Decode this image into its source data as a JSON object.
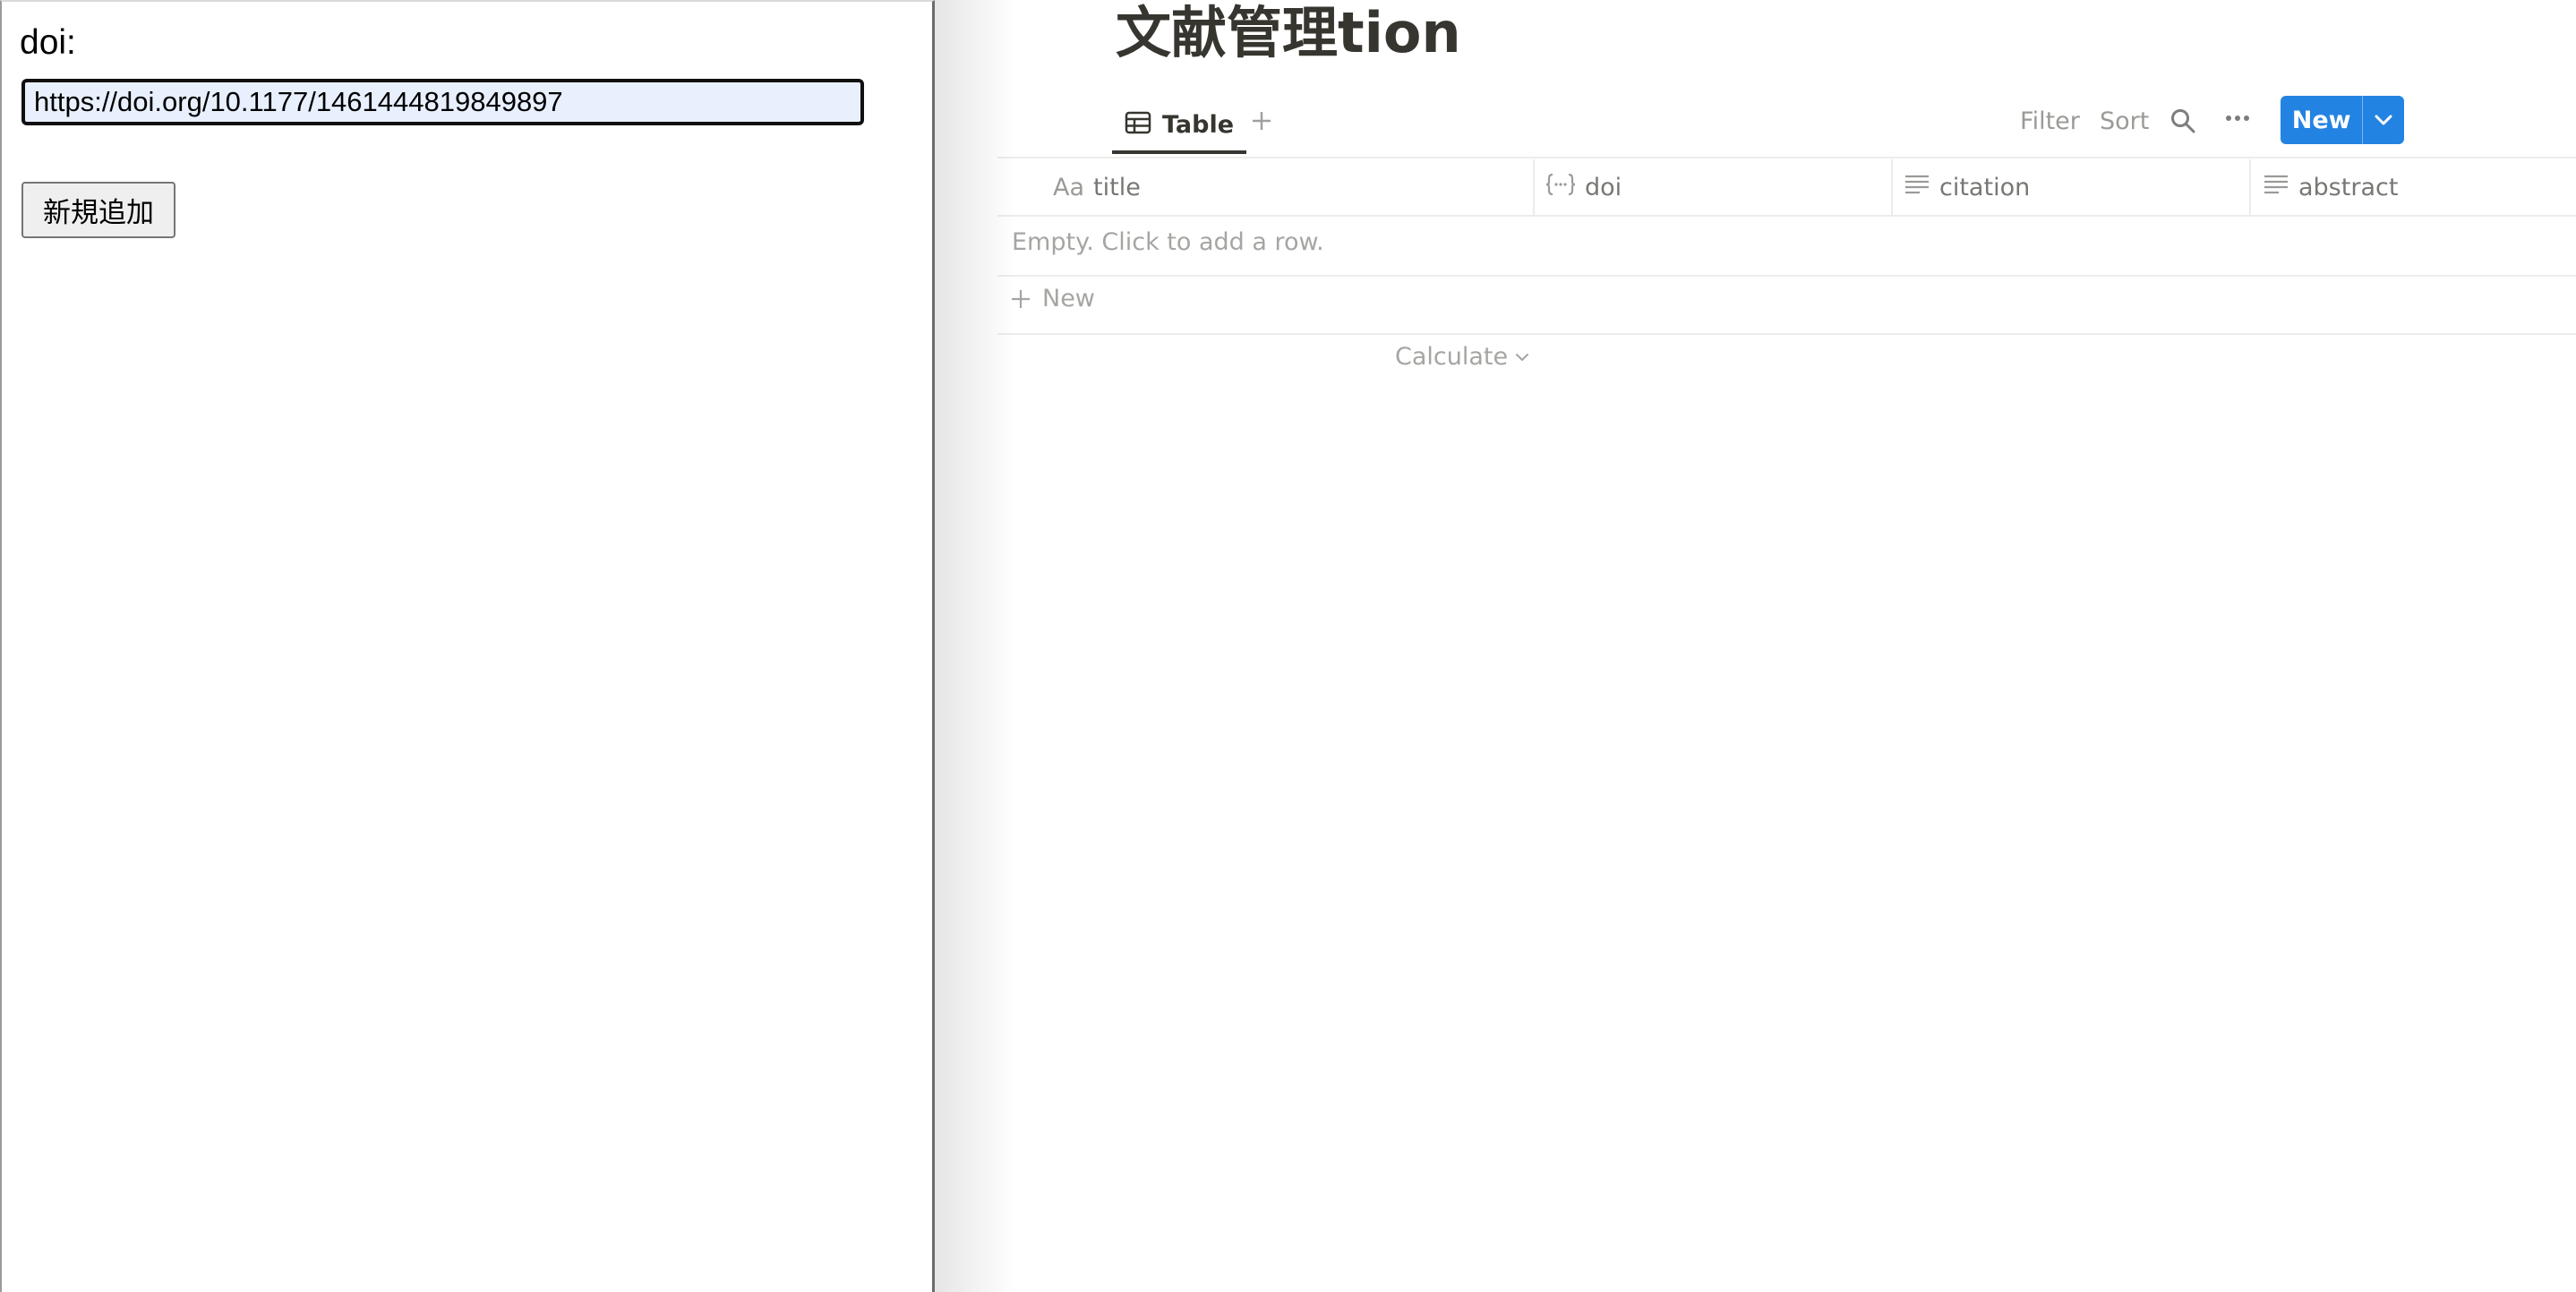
{
  "form": {
    "doi_label": "doi:",
    "doi_value": "https://doi.org/10.1177/1461444819849897",
    "add_button_label": "新規追加"
  },
  "database": {
    "title": "文献管理tion",
    "tabs": [
      {
        "label": "Table",
        "icon": "table-icon",
        "active": true
      }
    ],
    "toolbar": {
      "filter_label": "Filter",
      "sort_label": "Sort",
      "new_label": "New"
    },
    "columns": [
      {
        "label": "title",
        "icon": "title-aa-icon"
      },
      {
        "label": "doi",
        "icon": "formula-braces-icon"
      },
      {
        "label": "citation",
        "icon": "text-lines-icon"
      },
      {
        "label": "abstract",
        "icon": "text-lines-icon"
      }
    ],
    "empty_message": "Empty. Click to add a row.",
    "add_row_label": "New",
    "calculate_label": "Calculate"
  },
  "colors": {
    "accent": "#2383e2",
    "text": "#37352f",
    "muted": "#9b9a97",
    "input_fill": "#e8f0fe"
  }
}
